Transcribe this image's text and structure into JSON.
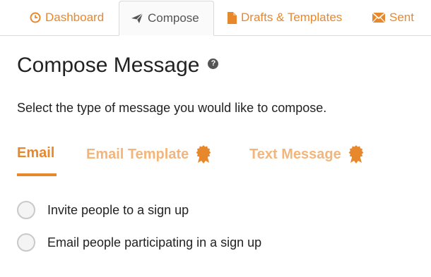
{
  "nav": {
    "tabs": [
      {
        "label": "Dashboard",
        "icon": "clock-icon"
      },
      {
        "label": "Compose",
        "icon": "paper-plane-icon",
        "active": true
      },
      {
        "label": "Drafts & Templates",
        "icon": "document-icon"
      },
      {
        "label": "Sent",
        "icon": "envelope-icon"
      }
    ]
  },
  "page": {
    "title": "Compose Message",
    "help_icon": "?",
    "instruction": "Select the type of message you would like to compose."
  },
  "message_types": {
    "tabs": [
      {
        "label": "Email",
        "active": true
      },
      {
        "label": "Email Template",
        "badge_icon": "premium-badge-icon"
      },
      {
        "label": "Text Message",
        "badge_icon": "premium-badge-icon"
      }
    ]
  },
  "options": [
    {
      "label": "Invite people to a sign up",
      "selected": false
    },
    {
      "label": "Email people participating in a sign up",
      "selected": false
    }
  ],
  "colors": {
    "accent": "#e8882c",
    "accent_light": "#f4b57a",
    "text": "#222222"
  }
}
